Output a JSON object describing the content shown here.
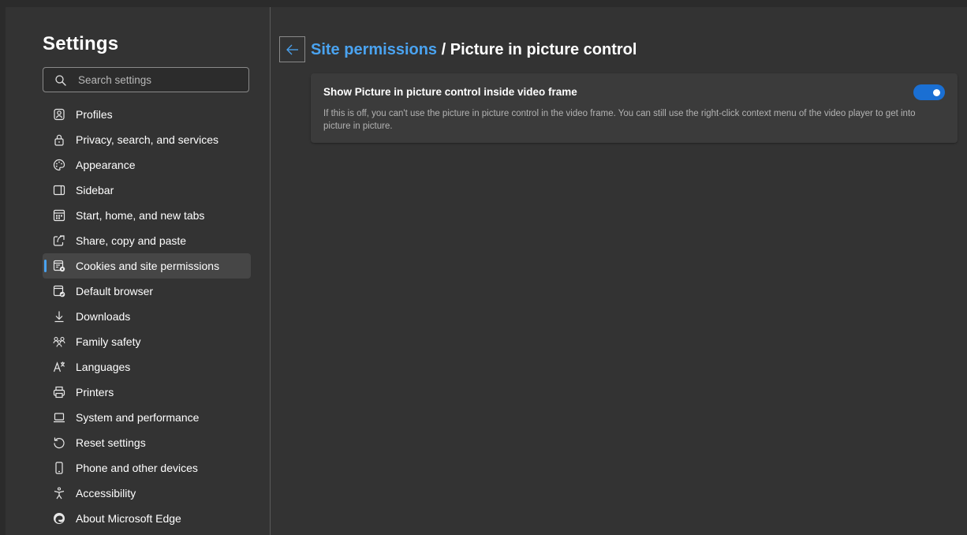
{
  "sidebar": {
    "title": "Settings",
    "search": {
      "placeholder": "Search settings",
      "value": ""
    },
    "items": [
      {
        "label": "Profiles",
        "icon": "profile-icon"
      },
      {
        "label": "Privacy, search, and services",
        "icon": "lock-icon"
      },
      {
        "label": "Appearance",
        "icon": "palette-icon"
      },
      {
        "label": "Sidebar",
        "icon": "sidebar-icon"
      },
      {
        "label": "Start, home, and new tabs",
        "icon": "home-grid-icon"
      },
      {
        "label": "Share, copy and paste",
        "icon": "share-icon"
      },
      {
        "label": "Cookies and site permissions",
        "icon": "cookies-permissions-icon",
        "selected": true
      },
      {
        "label": "Default browser",
        "icon": "default-browser-icon"
      },
      {
        "label": "Downloads",
        "icon": "download-icon"
      },
      {
        "label": "Family safety",
        "icon": "family-icon"
      },
      {
        "label": "Languages",
        "icon": "languages-icon"
      },
      {
        "label": "Printers",
        "icon": "printer-icon"
      },
      {
        "label": "System and performance",
        "icon": "laptop-icon"
      },
      {
        "label": "Reset settings",
        "icon": "reset-icon"
      },
      {
        "label": "Phone and other devices",
        "icon": "phone-icon"
      },
      {
        "label": "Accessibility",
        "icon": "accessibility-icon"
      },
      {
        "label": "About Microsoft Edge",
        "icon": "edge-logo-icon"
      }
    ]
  },
  "main": {
    "breadcrumb": {
      "parent": "Site permissions",
      "separator": "/",
      "current": "Picture in picture control"
    },
    "setting": {
      "title": "Show Picture in picture control inside video frame",
      "description": "If this is off, you can't use the picture in picture control in the video frame. You can still use the right-click context menu of the video player to get into picture in picture.",
      "enabled": true
    }
  },
  "colors": {
    "background": "#333333",
    "accent": "#4aa3f0",
    "toggle_on": "#1a6fd3",
    "card": "#3b3b3b",
    "selected_item": "#464646"
  }
}
